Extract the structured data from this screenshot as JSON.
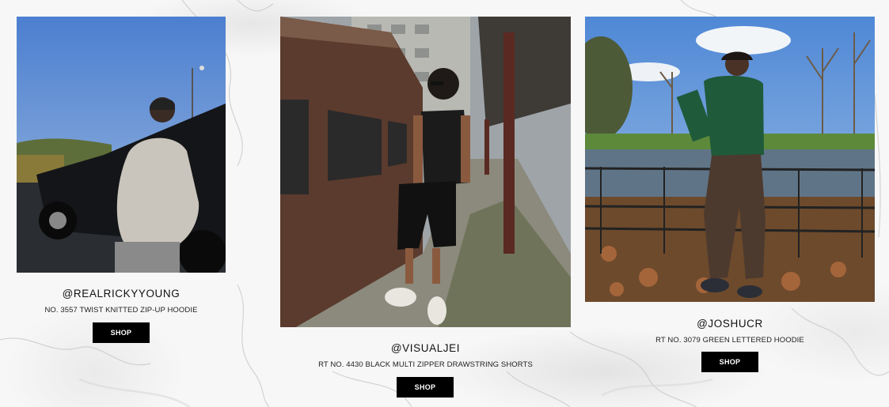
{
  "cards": [
    {
      "handle": "@REALRICKYYOUNG",
      "product": "NO. 3557 TWIST KNITTED ZIP-UP HOODIE",
      "shop_label": "SHOP",
      "photo": "man-in-knit-hoodie-by-black-jeep"
    },
    {
      "handle": "@VISUALJEI",
      "product": "RT NO. 4430 BLACK MULTI ZIPPER DRAWSTRING SHORTS",
      "shop_label": "SHOP",
      "photo": "man-in-black-vest-and-shorts-by-train"
    },
    {
      "handle": "@JOSHUCR",
      "product": "RT NO. 3079 GREEN LETTERED HOODIE",
      "shop_label": "SHOP",
      "photo": "man-in-green-hoodie-by-pond-fence"
    }
  ],
  "colors": {
    "background": "#f7f7f7",
    "button": "#000000",
    "button_text": "#ffffff"
  }
}
